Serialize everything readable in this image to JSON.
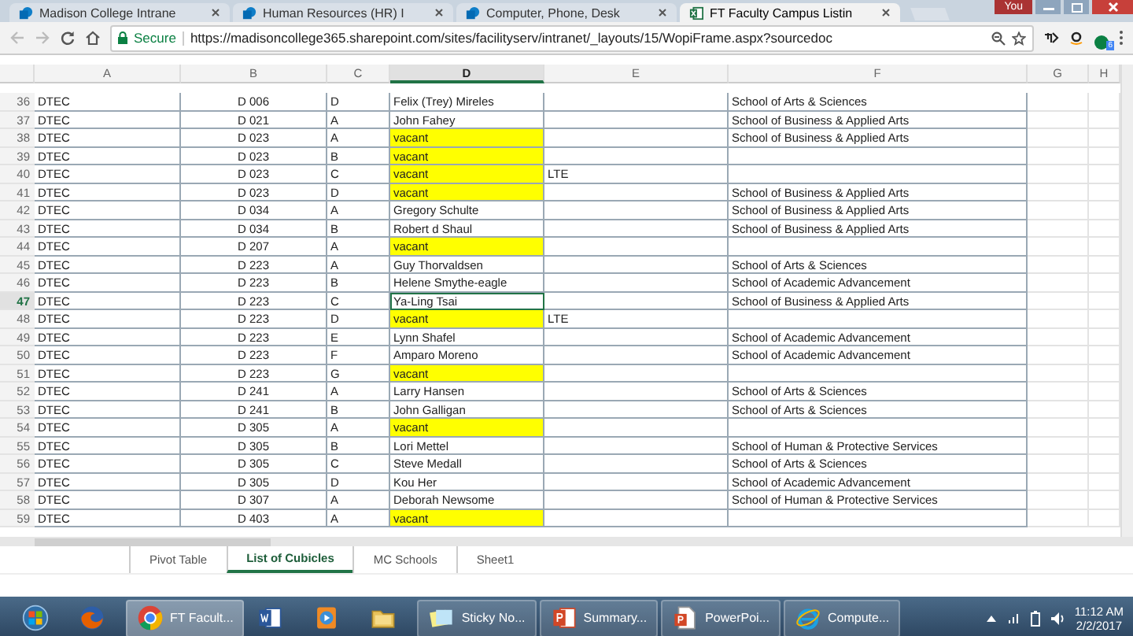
{
  "browser_tabs": [
    {
      "title": "Madison College Intrane",
      "selected": false,
      "kind": "sharepoint"
    },
    {
      "title": "Human Resources (HR) I",
      "selected": false,
      "kind": "sharepoint"
    },
    {
      "title": "Computer, Phone, Desk",
      "selected": false,
      "kind": "sharepoint"
    },
    {
      "title": "FT Faculty Campus Listin",
      "selected": true,
      "kind": "excel"
    }
  ],
  "profile": "You",
  "address_bar": {
    "security": "Secure",
    "url": "https://madisoncollege365.sharepoint.com/sites/facilityserv/intranet/_layouts/15/WopiFrame.aspx?sourcedoc"
  },
  "extension_badge": "6",
  "columns": [
    {
      "label": "A",
      "selected": false
    },
    {
      "label": "B",
      "selected": false
    },
    {
      "label": "C",
      "selected": false
    },
    {
      "label": "D",
      "selected": true
    },
    {
      "label": "E",
      "selected": false
    },
    {
      "label": "F",
      "selected": false
    },
    {
      "label": "G",
      "selected": false
    },
    {
      "label": "H",
      "selected": false
    }
  ],
  "rows": [
    {
      "num": "36",
      "a": "DTEC",
      "b": "D 006",
      "c": "D",
      "d": "Felix (Trey) Mireles",
      "e": "",
      "f": "School of Arts & Sciences",
      "highlighted": false,
      "selected": false
    },
    {
      "num": "37",
      "a": "DTEC",
      "b": "D 021",
      "c": "A",
      "d": "John Fahey",
      "e": "",
      "f": "School of Business & Applied Arts",
      "highlighted": false,
      "selected": false
    },
    {
      "num": "38",
      "a": "DTEC",
      "b": "D 023",
      "c": "A",
      "d": "vacant",
      "e": "",
      "f": "School of Business & Applied Arts",
      "highlighted": true,
      "selected": false
    },
    {
      "num": "39",
      "a": "DTEC",
      "b": "D 023",
      "c": "B",
      "d": "vacant",
      "e": "",
      "f": "",
      "highlighted": true,
      "selected": false
    },
    {
      "num": "40",
      "a": "DTEC",
      "b": "D 023",
      "c": "C",
      "d": "vacant",
      "e": "LTE",
      "f": "",
      "highlighted": true,
      "selected": false
    },
    {
      "num": "41",
      "a": "DTEC",
      "b": "D 023",
      "c": "D",
      "d": "vacant",
      "e": "",
      "f": "School of Business & Applied Arts",
      "highlighted": true,
      "selected": false
    },
    {
      "num": "42",
      "a": "DTEC",
      "b": "D 034",
      "c": "A",
      "d": "Gregory Schulte",
      "e": "",
      "f": "School of Business & Applied Arts",
      "highlighted": false,
      "selected": false
    },
    {
      "num": "43",
      "a": "DTEC",
      "b": "D 034",
      "c": "B",
      "d": "Robert d Shaul",
      "e": "",
      "f": "School of Business & Applied Arts",
      "highlighted": false,
      "selected": false
    },
    {
      "num": "44",
      "a": "DTEC",
      "b": "D 207",
      "c": "A",
      "d": "vacant",
      "e": "",
      "f": "",
      "highlighted": true,
      "selected": false
    },
    {
      "num": "45",
      "a": "DTEC",
      "b": "D 223",
      "c": "A",
      "d": "Guy Thorvaldsen",
      "e": "",
      "f": "School of Arts & Sciences",
      "highlighted": false,
      "selected": false
    },
    {
      "num": "46",
      "a": "DTEC",
      "b": "D 223",
      "c": "B",
      "d": "Helene Smythe-eagle",
      "e": "",
      "f": "School of Academic Advancement",
      "highlighted": false,
      "selected": false
    },
    {
      "num": "47",
      "a": "DTEC",
      "b": "D 223",
      "c": "C",
      "d": "Ya-Ling Tsai",
      "e": "",
      "f": "School of Business & Applied Arts",
      "highlighted": false,
      "selected": true
    },
    {
      "num": "48",
      "a": "DTEC",
      "b": "D 223",
      "c": "D",
      "d": "vacant",
      "e": "LTE",
      "f": "",
      "highlighted": true,
      "selected": false
    },
    {
      "num": "49",
      "a": "DTEC",
      "b": "D 223",
      "c": "E",
      "d": "Lynn Shafel",
      "e": "",
      "f": "School of Academic Advancement",
      "highlighted": false,
      "selected": false
    },
    {
      "num": "50",
      "a": "DTEC",
      "b": "D 223",
      "c": "F",
      "d": "Amparo Moreno",
      "e": "",
      "f": "School of Academic Advancement",
      "highlighted": false,
      "selected": false
    },
    {
      "num": "51",
      "a": "DTEC",
      "b": "D 223",
      "c": "G",
      "d": "vacant",
      "e": "",
      "f": "",
      "highlighted": true,
      "selected": false
    },
    {
      "num": "52",
      "a": "DTEC",
      "b": "D 241",
      "c": "A",
      "d": "Larry Hansen",
      "e": "",
      "f": "School of Arts & Sciences",
      "highlighted": false,
      "selected": false
    },
    {
      "num": "53",
      "a": "DTEC",
      "b": "D 241",
      "c": "B",
      "d": "John Galligan",
      "e": "",
      "f": "School of Arts & Sciences",
      "highlighted": false,
      "selected": false
    },
    {
      "num": "54",
      "a": "DTEC",
      "b": "D 305",
      "c": "A",
      "d": "vacant",
      "e": "",
      "f": "",
      "highlighted": true,
      "selected": false
    },
    {
      "num": "55",
      "a": "DTEC",
      "b": "D 305",
      "c": "B",
      "d": "Lori Mettel",
      "e": "",
      "f": "School of Human & Protective Services",
      "highlighted": false,
      "selected": false
    },
    {
      "num": "56",
      "a": "DTEC",
      "b": "D 305",
      "c": "C",
      "d": "Steve Medall",
      "e": "",
      "f": "School of Arts & Sciences",
      "highlighted": false,
      "selected": false
    },
    {
      "num": "57",
      "a": "DTEC",
      "b": "D 305",
      "c": "D",
      "d": "Kou Her",
      "e": "",
      "f": "School of Academic Advancement",
      "highlighted": false,
      "selected": false
    },
    {
      "num": "58",
      "a": "DTEC",
      "b": "D 307",
      "c": "A",
      "d": "Deborah Newsome",
      "e": "",
      "f": "School of Human & Protective Services",
      "highlighted": false,
      "selected": false
    },
    {
      "num": "59",
      "a": "DTEC",
      "b": "D 403",
      "c": "A",
      "d": "vacant",
      "e": "",
      "f": "",
      "highlighted": true,
      "selected": false
    }
  ],
  "sheet_tabs": [
    {
      "label": "Pivot Table",
      "selected": false
    },
    {
      "label": "List of Cubicles",
      "selected": true
    },
    {
      "label": "MC Schools",
      "selected": false
    },
    {
      "label": "Sheet1",
      "selected": false
    }
  ],
  "taskbar": [
    {
      "kind": "start",
      "selected": false
    },
    {
      "kind": "firefox",
      "selected": false
    },
    {
      "kind": "chrome",
      "label": "FT Facult...",
      "selected": true
    },
    {
      "kind": "word",
      "selected": false
    },
    {
      "kind": "media",
      "selected": false
    },
    {
      "kind": "folder",
      "selected": false
    },
    {
      "kind": "sticky",
      "label": "Sticky No...",
      "selected": false
    },
    {
      "kind": "powerpoint",
      "label": "Summary...",
      "selected": false
    },
    {
      "kind": "ppt-doc",
      "label": "PowerPoi...",
      "selected": false
    },
    {
      "kind": "ie",
      "label": "Compute...",
      "selected": false
    }
  ],
  "clock": {
    "time": "11:12 AM",
    "date": "2/2/2017"
  }
}
